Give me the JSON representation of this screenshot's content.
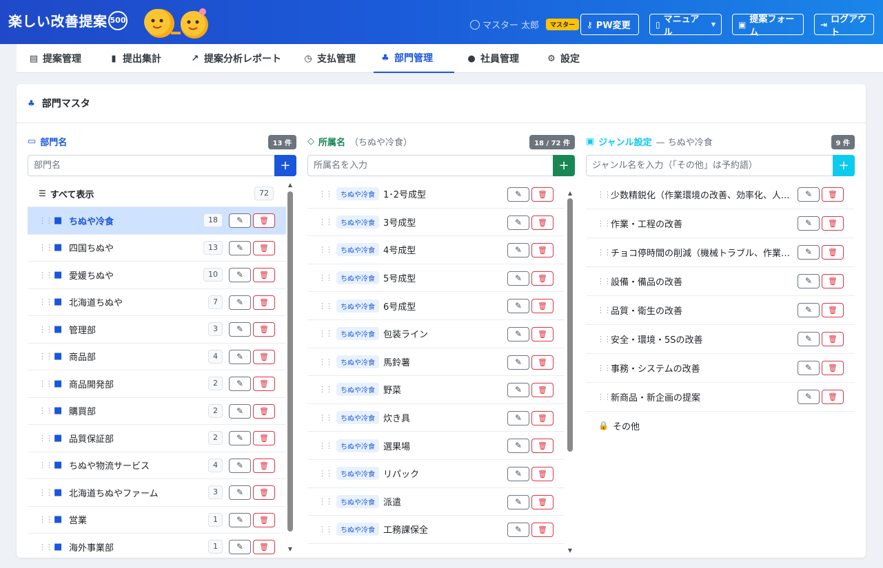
{
  "header": {
    "brand": "楽しい改善提案",
    "logo_number": "500",
    "user_name": "マスター 太郎",
    "role": "マスター",
    "buttons": {
      "pw": "PW変更",
      "manual": "マニュアル",
      "form": "提案フォーム",
      "logout": "ログアウト"
    }
  },
  "nav": [
    {
      "label": "提案管理",
      "icon": "document-icon"
    },
    {
      "label": "提出集計",
      "icon": "bar-chart-icon"
    },
    {
      "label": "提案分析レポート",
      "icon": "line-chart-icon"
    },
    {
      "label": "支払管理",
      "icon": "payment-icon"
    },
    {
      "label": "部門管理",
      "icon": "org-icon",
      "active": true
    },
    {
      "label": "社員管理",
      "icon": "users-icon"
    },
    {
      "label": "設定",
      "icon": "gear-icon"
    }
  ],
  "page": {
    "title": "部門マスタ"
  },
  "departments": {
    "title": "部門名",
    "count": "13 件",
    "placeholder": "部門名",
    "show_all": {
      "label": "すべて表示",
      "count": "72"
    },
    "items": [
      {
        "name": "ちぬや冷食",
        "count": "18",
        "selected": true
      },
      {
        "name": "四国ちぬや",
        "count": "13"
      },
      {
        "name": "愛媛ちぬや",
        "count": "10"
      },
      {
        "name": "北海道ちぬや",
        "count": "7"
      },
      {
        "name": "管理部",
        "count": "3"
      },
      {
        "name": "商品部",
        "count": "4"
      },
      {
        "name": "商品開発部",
        "count": "2"
      },
      {
        "name": "購買部",
        "count": "2"
      },
      {
        "name": "品質保証部",
        "count": "2"
      },
      {
        "name": "ちぬや物流サービス",
        "count": "4"
      },
      {
        "name": "北海道ちぬやファーム",
        "count": "3"
      },
      {
        "name": "営業",
        "count": "1"
      },
      {
        "name": "海外事業部",
        "count": "1"
      }
    ]
  },
  "affiliations": {
    "title": "所属名",
    "subtitle": "（ちぬや冷食）",
    "count": "18 / 72 件",
    "placeholder": "所属名を入力",
    "tag": "ちぬや冷食",
    "items": [
      "1･2号成型",
      "3号成型",
      "4号成型",
      "5号成型",
      "6号成型",
      "包装ライン",
      "馬鈴薯",
      "野菜",
      "炊き具",
      "選果場",
      "リパック",
      "派遣",
      "工務課保全"
    ]
  },
  "genres": {
    "title": "ジャンル設定",
    "subtitle": "— ちぬや冷食",
    "count": "9 件",
    "placeholder": "ジャンル名を入力（「その他」は予約語）",
    "items": [
      "少数精鋭化（作業環境の改善、効率化、人...",
      "作業・工程の改善",
      "チョコ停時間の削減（機械トラブル、作業ミス...",
      "設備・備品の改善",
      "品質・衛生の改善",
      "安全・環境・5Sの改善",
      "事務・システムの改善",
      "新商品・新企画の提案"
    ],
    "reserved": "その他"
  },
  "colors": {
    "primary": "#1a56db",
    "green": "#198754",
    "cyan": "#0dcaf0",
    "danger": "#dc3545"
  }
}
